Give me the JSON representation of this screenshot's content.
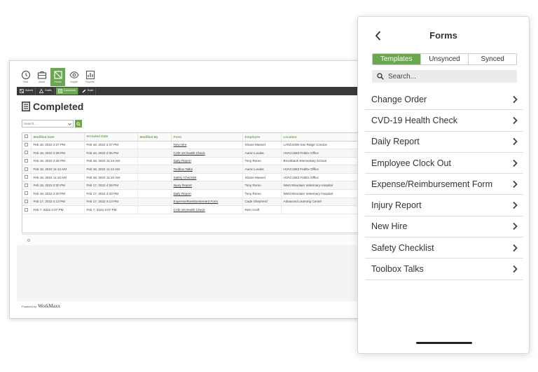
{
  "desktop": {
    "nav": [
      {
        "label": "Time",
        "icon": "clock-icon"
      },
      {
        "label": "Asset",
        "icon": "briefcase-icon"
      },
      {
        "label": "Forms",
        "icon": "forms-icon",
        "active": true
      },
      {
        "label": "Insight",
        "icon": "eye-icon"
      },
      {
        "label": "Reports",
        "icon": "chart-icon"
      }
    ],
    "subnav": [
      {
        "label": "Submit",
        "icon": "submit-icon"
      },
      {
        "label": "Drafts",
        "icon": "warning-icon"
      },
      {
        "label": "Completed",
        "icon": "list-icon",
        "active": true
      },
      {
        "label": "Build",
        "icon": "pen-icon"
      }
    ],
    "page_title": "Completed",
    "search_placeholder": "Search...",
    "table": {
      "headers": [
        "Modified Date",
        "Created Date",
        "Modified By",
        "Form",
        "Employee",
        "Location"
      ],
      "rows": [
        [
          "Feb 18, 2022 2:37 PM",
          "Feb 18, 2022 2:37 PM",
          "",
          "New Hire",
          "Shane Manvel",
          "LAND1008 San Ridge Condos"
        ],
        [
          "Feb 18, 2022 2:36 PM",
          "Feb 18, 2022 2:36 PM",
          "",
          "CVD-19 Health Check",
          "Aaron Lealos",
          "HVAC1583 FedEx Office"
        ],
        [
          "Feb 18, 2022 2:35 PM",
          "Feb 18, 2022 11:14 AM",
          "",
          "Daily Report",
          "Tony Romo",
          "Brockbank Elementary School"
        ],
        [
          "Feb 18, 2022 11:12 AM",
          "Feb 18, 2022 11:12 AM",
          "",
          "Toolbox Talks",
          "Aaron Lealos",
          "HVAC1583 FedEx Office"
        ],
        [
          "Feb 18, 2022 11:10 AM",
          "Feb 18, 2022 11:10 AM",
          "",
          "Safety Checklist",
          "Shane Manvel",
          "HVAC1583 FedEx Office"
        ],
        [
          "Feb 18, 2022 2:30 PM",
          "Feb 17, 2022 4:39 PM",
          "",
          "Injury Report",
          "Tony Romo",
          "West Mountain Veterinary Hospital"
        ],
        [
          "Feb 18, 2022 2:30 PM",
          "Feb 17, 2022 4:33 PM",
          "",
          "Daily Report",
          "Tony Romo",
          "West Mountain Veterinary Hospital"
        ],
        [
          "Feb 17, 2022 4:13 PM",
          "Feb 17, 2022 4:13 PM",
          "",
          "Expense/Reimbursement Form",
          "Cade Shepherd",
          "Advanced Learning Center"
        ],
        [
          "Feb 7, 2022 4:07 PM",
          "Feb 7, 2022 4:07 PM",
          "",
          "CVD-19 Health Check",
          "Rein Croft",
          ""
        ]
      ]
    },
    "powered_by": "Powered by",
    "brand": "WorkMaxx"
  },
  "mobile": {
    "title": "Forms",
    "tabs": [
      {
        "label": "Templates",
        "active": true
      },
      {
        "label": "Unsynced"
      },
      {
        "label": "Synced"
      }
    ],
    "search_placeholder": "Search...",
    "items": [
      "Change Order",
      "CVD-19 Health Check",
      "Daily Report",
      "Employee Clock Out",
      "Expense/Reimbursement Form",
      "Injury Report",
      "New Hire",
      "Safety Checklist",
      "Toolbox Talks"
    ]
  },
  "colors": {
    "accent": "#6aa84f",
    "dark_bar": "#3a3a3a"
  }
}
